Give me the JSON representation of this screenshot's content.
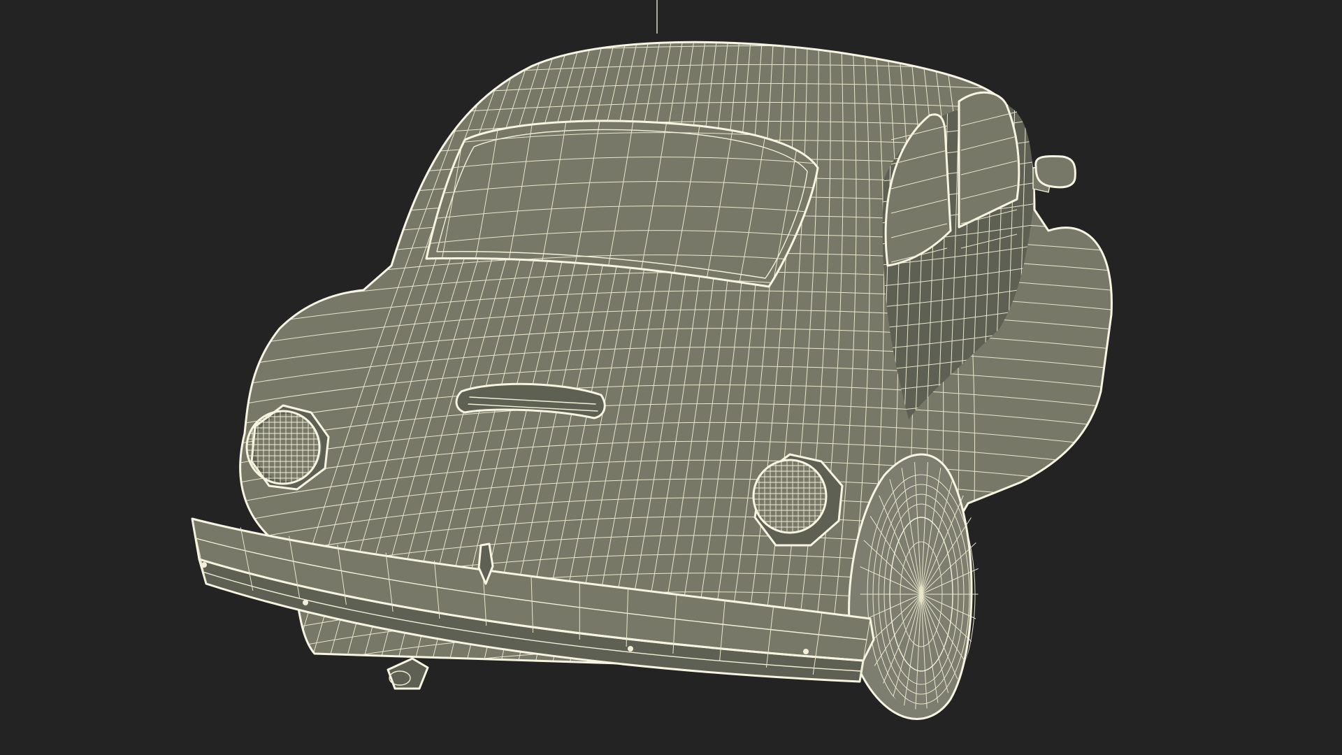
{
  "scene": {
    "subject": "",
    "background_color": "#232323",
    "wire_color": "#f2f0d8",
    "surface_color": "#777868"
  },
  "icons": {
    "marker": "vertical-guide-line"
  }
}
